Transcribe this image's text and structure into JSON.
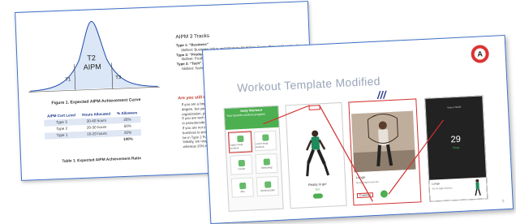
{
  "back_slide": {
    "curve_label_t1": "T1",
    "curve_label_t2a": "T2",
    "curve_label_t2b": "AIPM",
    "curve_label_t3": "T3",
    "figure_caption": "Figure 1. Expected AIPM Achievement Curve",
    "table": {
      "headers": [
        "AIPM Cert Level",
        "Hours Allocated",
        "% Allowees"
      ],
      "rows": [
        [
          "Type 3",
          "30-40 hours",
          "25%"
        ],
        [
          "Type 2",
          "20-30 hours",
          "50%"
        ],
        [
          "Type 1",
          "10-20 hours",
          "25%"
        ],
        [
          "",
          "",
          "100%"
        ]
      ]
    },
    "table_caption": "Table 1. Expected AIPM Achievement Ratio",
    "tracks_title": "AIPM 3 Tracks",
    "track1": "Type 1: “Business”",
    "track1_skill": "Skillset: Business Value and Strategy Modeling, Scope Plan and Leadership",
    "track2": "Type 2: “Product” (A",
    "track2_skill": "Skillset: Product b... Business and Tec...",
    "track3": "Type 3: “Tech” Savv",
    "track3_skill": "Skillset: Technical",
    "unsure_title": "Are you still not sure",
    "unsure_lines": [
      "If you are a beginner",
      "degree, but you want",
      "organization, pick Typ",
      "If you are tech savvy",
      "in pseudocode level, y",
      "If you are not sure bet",
      "business to produce a",
      "be in Type 2 Full Prod",
      "Initially, we roughly ex",
      "whereas 20% each will"
    ]
  },
  "front_slide": {
    "title": "Workout Template Modified",
    "logo_letter": "A",
    "phone1": {
      "header_title": "Daily Workout",
      "header_sub": "Your favorite workout program",
      "cells": [
        "Upper body workout",
        "Lower body workout",
        "Cardio",
        "Stretching",
        "Abs",
        "Workout plan"
      ]
    },
    "phone2": {
      "ready": "Ready to go!",
      "go": "Go!"
    },
    "phone3": {
      "label": "Lunge",
      "sub": "Bodyweight exercise",
      "coach": "Coaches"
    },
    "phone4": {
      "top": "View it NOW",
      "number": "29",
      "reps": "Reps",
      "foot_title": "Lunge",
      "foot_sub": "20 Hi-High kickses"
    },
    "page_number": "5"
  }
}
